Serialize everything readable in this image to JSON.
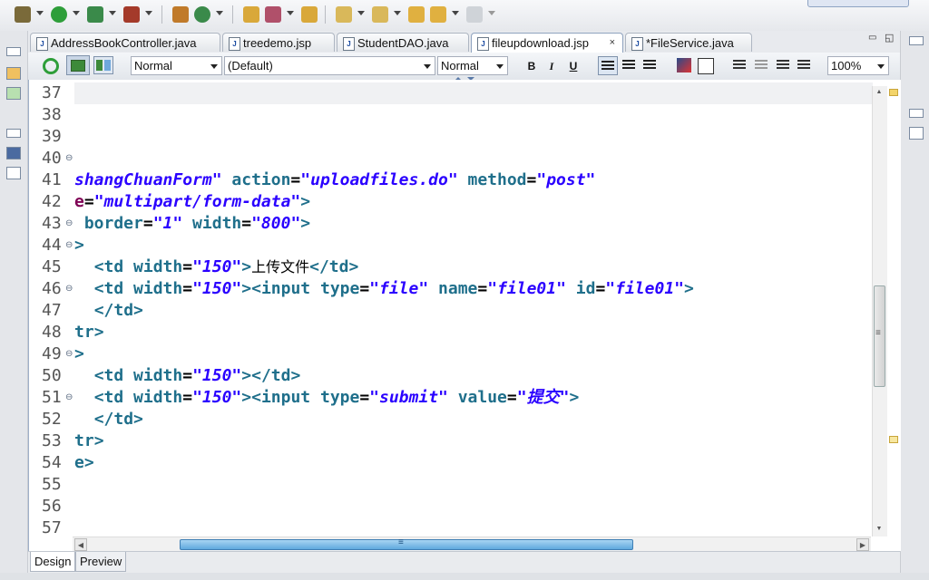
{
  "tabs": [
    {
      "label": "AddressBookController.java",
      "icon": "java-file-icon",
      "icon_glyph": "J"
    },
    {
      "label": "treedemo.jsp",
      "icon": "jsp-file-icon",
      "icon_glyph": "J"
    },
    {
      "label": "StudentDAO.java",
      "icon": "java-file-icon",
      "icon_glyph": "J"
    },
    {
      "label": "fileupdownload.jsp",
      "icon": "jsp-file-icon",
      "icon_glyph": "J",
      "active": true,
      "close": "×"
    },
    {
      "label": "*FileService.java",
      "icon": "java-file-icon",
      "icon_glyph": "J"
    }
  ],
  "window_buttons": {
    "minimize": "▭",
    "maximize": "◱"
  },
  "design_toolbar": {
    "paragraph_style": "Normal",
    "font": "(Default)",
    "font_size": "Normal",
    "bold": "B",
    "italic": "I",
    "underline": "U",
    "zoom": "100%"
  },
  "editor": {
    "lines": [
      {
        "n": "37",
        "fold": "",
        "code": ""
      },
      {
        "n": "38",
        "fold": "",
        "code": ""
      },
      {
        "n": "39",
        "fold": "",
        "code": ""
      },
      {
        "n": "40",
        "fold": "⊖",
        "code": ""
      },
      {
        "n": "41",
        "fold": "",
        "code": "shangChuanForm\" action=\"uploadfiles.do\" method=\"post\""
      },
      {
        "n": "42",
        "fold": "",
        "code": "e=\"multipart/form-data\">"
      },
      {
        "n": "43",
        "fold": "⊖",
        "code": " border=\"1\" width=\"800\">"
      },
      {
        "n": "44",
        "fold": "⊖",
        "code": ">"
      },
      {
        "n": "45",
        "fold": "",
        "code": "  <td width=\"150\">上传文件</td>"
      },
      {
        "n": "46",
        "fold": "⊖",
        "code": "  <td width=\"150\"><input type=\"file\" name=\"file01\" id=\"file01\">"
      },
      {
        "n": "47",
        "fold": "",
        "code": "  </td>"
      },
      {
        "n": "48",
        "fold": "",
        "code": "tr>"
      },
      {
        "n": "49",
        "fold": "⊖",
        "code": ">"
      },
      {
        "n": "50",
        "fold": "",
        "code": "  <td width=\"150\"></td>"
      },
      {
        "n": "51",
        "fold": "⊖",
        "code": "  <td width=\"150\"><input type=\"submit\" value=\"提交\">"
      },
      {
        "n": "52",
        "fold": "",
        "code": "  </td>"
      },
      {
        "n": "53",
        "fold": "",
        "code": "tr>"
      },
      {
        "n": "54",
        "fold": "",
        "code": "e>"
      },
      {
        "n": "55",
        "fold": "",
        "code": ""
      },
      {
        "n": "56",
        "fold": "",
        "code": ""
      },
      {
        "n": "57",
        "fold": "",
        "code": ""
      }
    ]
  },
  "scroll_glyphs": {
    "up": "▲",
    "down": "▼",
    "left": "◀",
    "right": "▶",
    "grip": "≡"
  },
  "bottom_tabs": [
    {
      "label": "Design",
      "active": true
    },
    {
      "label": "Preview"
    }
  ],
  "colors": {
    "keyword": "#7f0055",
    "tag": "#1f6f8b",
    "string": "#2a00ff"
  }
}
